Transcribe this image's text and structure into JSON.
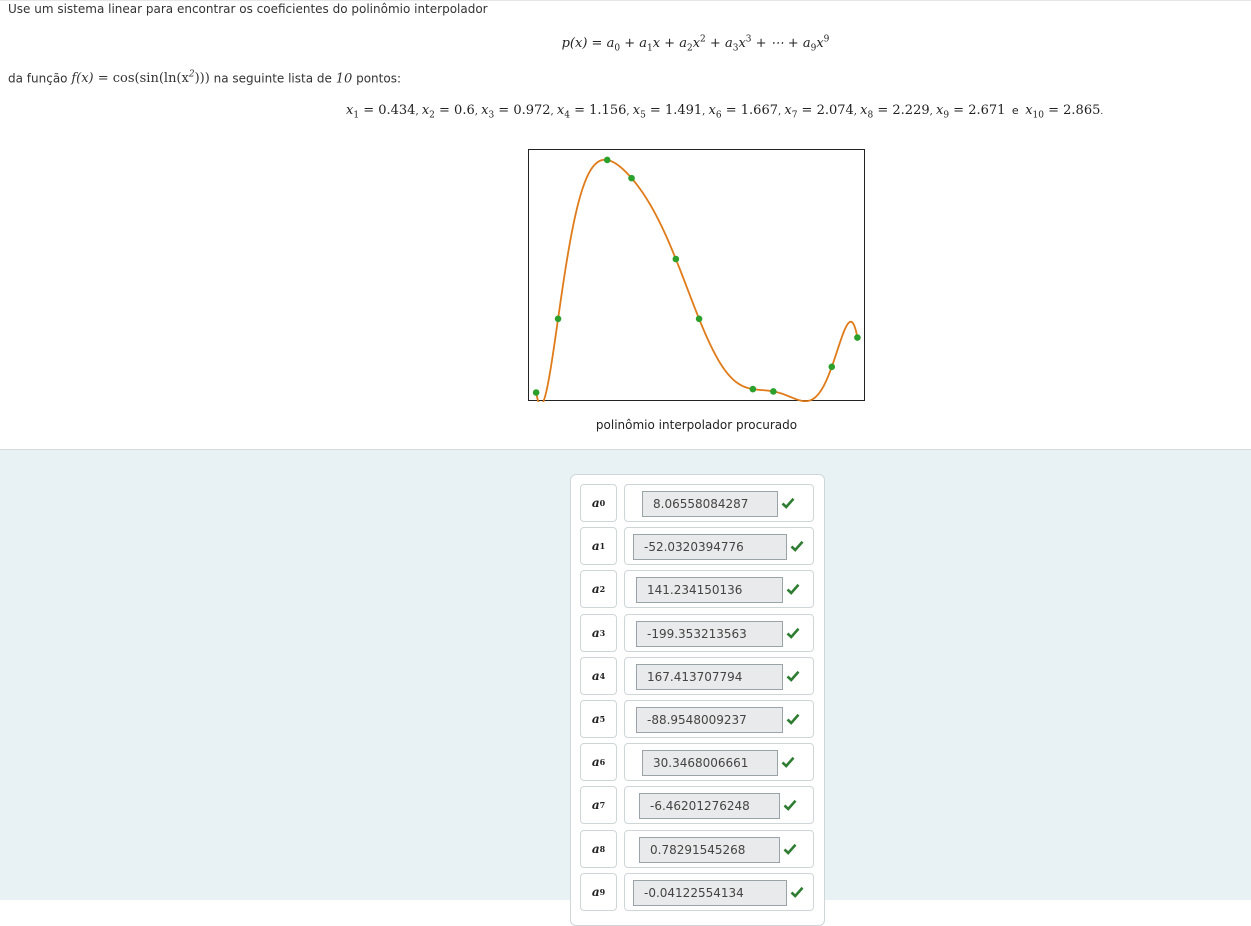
{
  "intro_text": "Use um sistema linear para encontrar os coeficientes do polinômio interpolador",
  "polynomial": {
    "lhs": "p(x) = ",
    "terms": [
      "a",
      "0",
      " + a",
      "1",
      "x + a",
      "2",
      "x",
      "2",
      " + a",
      "3",
      "x",
      "3",
      " + ⋯ + a",
      "9",
      "x",
      "9"
    ]
  },
  "function_line": {
    "prefix": "da função ",
    "func_lhs": "f(x) = ",
    "func_rhs": "cos(sin(ln(x",
    "func_exp": "2",
    "func_close": ")))",
    "middle": " na seguinte lista de ",
    "count": "10",
    "suffix": " pontos:"
  },
  "points": [
    {
      "idx": "1",
      "val": "0.434"
    },
    {
      "idx": "2",
      "val": "0.6"
    },
    {
      "idx": "3",
      "val": "0.972"
    },
    {
      "idx": "4",
      "val": "1.156"
    },
    {
      "idx": "5",
      "val": "1.491"
    },
    {
      "idx": "6",
      "val": "1.667"
    },
    {
      "idx": "7",
      "val": "2.074"
    },
    {
      "idx": "8",
      "val": "2.229"
    },
    {
      "idx": "9",
      "val": "2.671"
    },
    {
      "idx": "10",
      "val": "2.865"
    }
  ],
  "points_joiner": "e",
  "plot_caption": "polinômio interpolador procurado",
  "chart_data": {
    "type": "line",
    "title": "",
    "x": [
      0.434,
      0.6,
      0.972,
      1.156,
      1.491,
      1.667,
      2.074,
      2.229,
      2.671,
      2.865
    ],
    "y": [
      -0.999,
      -0.37,
      0.985,
      0.83,
      0.14,
      -0.37,
      -0.97,
      -0.99,
      -0.78,
      -0.53
    ],
    "curve_color": "#e07b1a",
    "point_color": "#2ca02c"
  },
  "coefficients": [
    {
      "label": "a",
      "sub": "0",
      "value": "8.06558084287"
    },
    {
      "label": "a",
      "sub": "1",
      "value": "-52.0320394776"
    },
    {
      "label": "a",
      "sub": "2",
      "value": "141.234150136"
    },
    {
      "label": "a",
      "sub": "3",
      "value": "-199.353213563"
    },
    {
      "label": "a",
      "sub": "4",
      "value": "167.413707794"
    },
    {
      "label": "a",
      "sub": "5",
      "value": "-88.9548009237"
    },
    {
      "label": "a",
      "sub": "6",
      "value": "30.3468006661"
    },
    {
      "label": "a",
      "sub": "7",
      "value": "-6.46201276248"
    },
    {
      "label": "a",
      "sub": "8",
      "value": "0.78291545268"
    },
    {
      "label": "a",
      "sub": "9",
      "value": "-0.04122554134"
    }
  ],
  "colors": {
    "check": "#2e7d32",
    "bottom_bg": "#e8f2f4"
  },
  "icons": {
    "correct": "check-icon"
  }
}
